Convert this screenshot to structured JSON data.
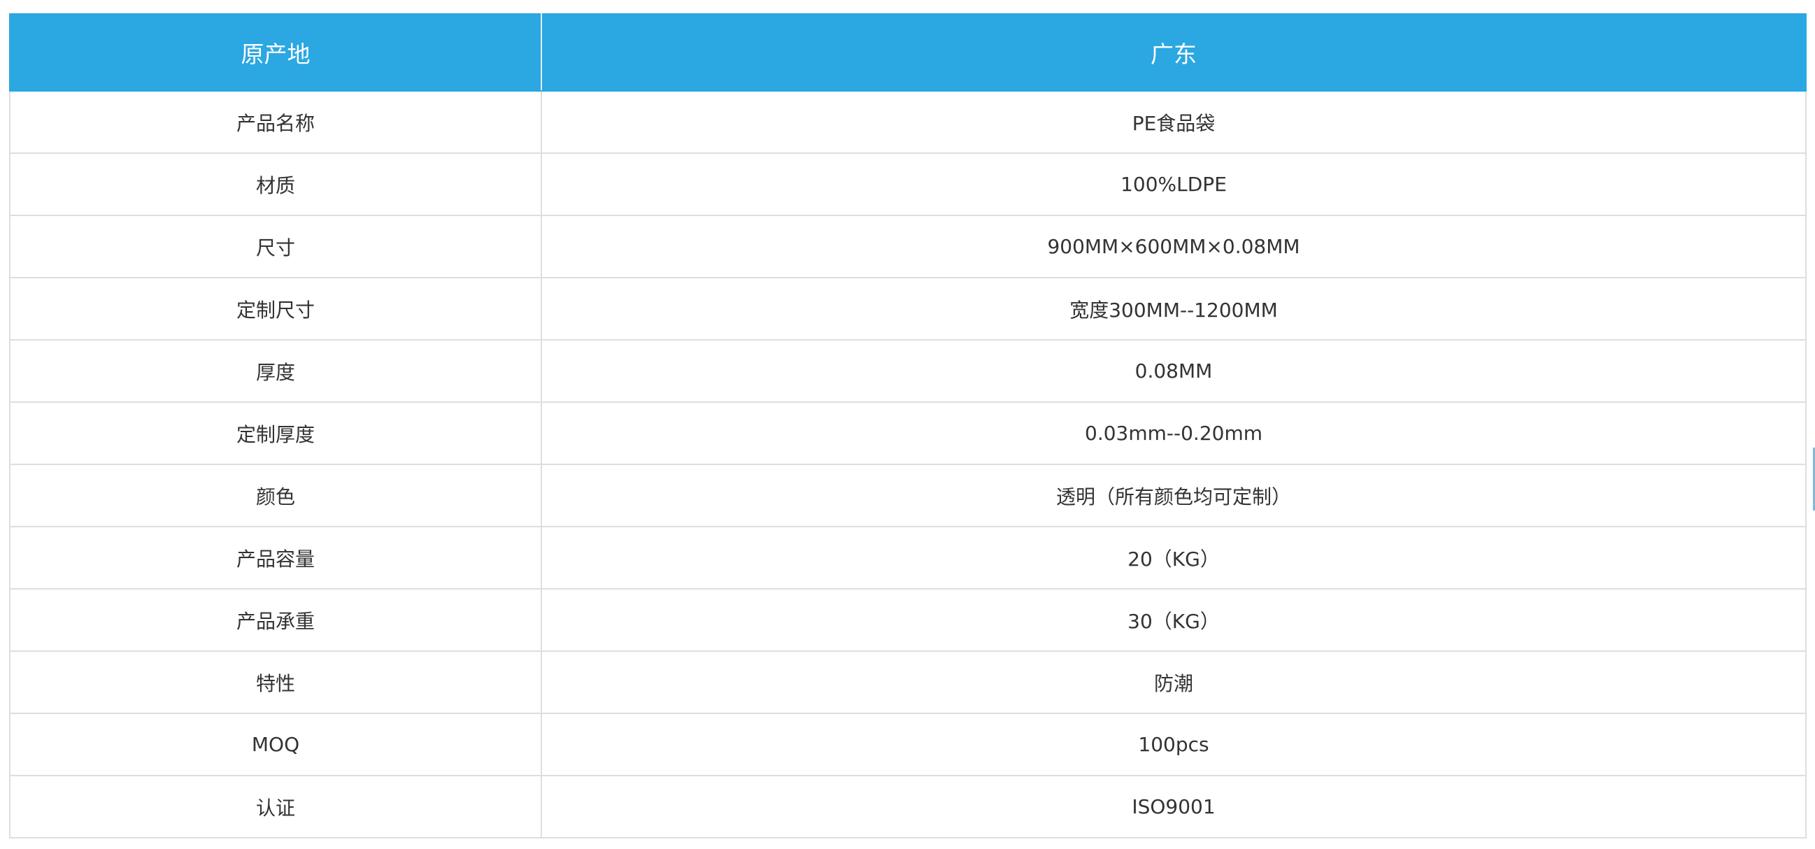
{
  "table": {
    "header": {
      "label": "原产地",
      "value": "广东"
    },
    "rows": [
      {
        "label": "产品名称",
        "value": "PE食品袋"
      },
      {
        "label": "材质",
        "value": "100%LDPE"
      },
      {
        "label": "尺寸",
        "value": "900MM×600MM×0.08MM"
      },
      {
        "label": "定制尺寸",
        "value": "宽度300MM--1200MM"
      },
      {
        "label": "厚度",
        "value": "0.08MM"
      },
      {
        "label": "定制厚度",
        "value": "0.03mm--0.20mm"
      },
      {
        "label": "颜色",
        "value": "透明（所有颜色均可定制）"
      },
      {
        "label": "产品容量",
        "value": "20（KG）"
      },
      {
        "label": "产品承重",
        "value": "30（KG）"
      },
      {
        "label": "特性",
        "value": "防潮"
      },
      {
        "label": "MOQ",
        "value": "100pcs"
      },
      {
        "label": "认证",
        "value": "ISO9001"
      }
    ]
  },
  "colors": {
    "header_bg": "#2ba7e2",
    "header_text": "#ffffff",
    "border": "#dedede",
    "body_text": "#333333"
  }
}
